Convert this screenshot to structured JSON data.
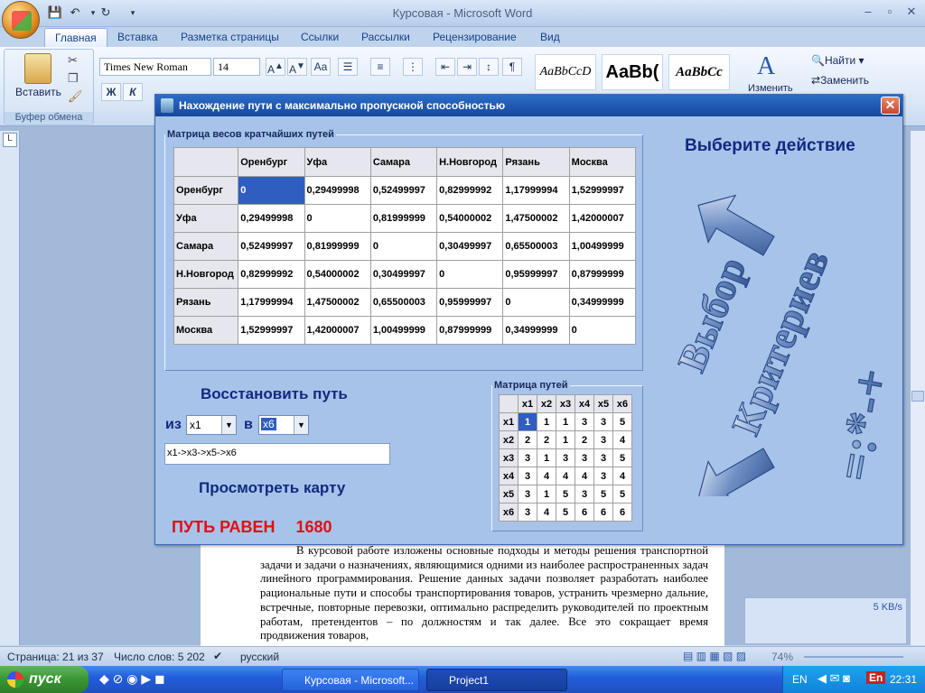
{
  "word": {
    "window_title": "Курсовая - Microsoft Word",
    "tabs": [
      "Главная",
      "Вставка",
      "Разметка страницы",
      "Ссылки",
      "Рассылки",
      "Рецензирование",
      "Вид"
    ],
    "ribbon": {
      "paste_label": "Вставить",
      "clipboard_group": "Буфер обмена",
      "font_name": "Times New Roman",
      "font_size": "14",
      "styles": [
        "AaBbCcD",
        "AaBb(",
        "AaBbCc"
      ],
      "edit_style_label": "Изменить",
      "find_label": "Найти",
      "replace_label": "Заменить",
      "bold": "Ж",
      "italic": "К"
    },
    "doc_text": "В курсовой работе изложены основные подходы и методы решения транспортной задачи и задачи о назначениях, являющимися одними из наиболее распространенных задач линейного программирования. Решение данных задачи позволяет разработать наиболее рациональные пути и способы транспортирования товаров, устранить чрезмерно дальние, встречные, повторные перевозки, оптимально распределить руководителей по проектным работам, претендентов – по должностям и так далее. Все это сокращает время продвижения товаров,",
    "status": {
      "page": "Страница: 21 из 37",
      "words": "Число слов: 5 202",
      "language": "русский",
      "zoom": "74%"
    },
    "net_speed": "5 KB/s"
  },
  "taskbar": {
    "start": "пуск",
    "tasks": [
      "Курсовая - Microsoft...",
      "Project1"
    ],
    "lang": "EN",
    "lang2": "En",
    "clock": "22:31"
  },
  "dialog": {
    "title": "Нахождение пути с максимально пропускной способностью",
    "weights_legend": "Матрица весов кратчайших путей",
    "cities": [
      "Оренбург",
      "Уфа",
      "Самара",
      "Н.Новгород",
      "Рязань",
      "Москва"
    ],
    "weights": [
      [
        "0",
        "0,29499998",
        "0,52499997",
        "0,82999992",
        "1,17999994",
        "1,52999997"
      ],
      [
        "0,29499998",
        "0",
        "0,81999999",
        "0,54000002",
        "1,47500002",
        "1,42000007"
      ],
      [
        "0,52499997",
        "0,81999999",
        "0",
        "0,30499997",
        "0,65500003",
        "1,00499999"
      ],
      [
        "0,82999992",
        "0,54000002",
        "0,30499997",
        "0",
        "0,95999997",
        "0,87999999"
      ],
      [
        "1,17999994",
        "1,47500002",
        "0,65500003",
        "0,95999997",
        "0",
        "0,34999999"
      ],
      [
        "1,52999997",
        "1,42000007",
        "1,00499999",
        "0,87999999",
        "0,34999999",
        "0"
      ]
    ],
    "choose_action": "Выберите действие",
    "criteria_1": "Выбор",
    "criteria_2": "Критериев",
    "restore_path": "Восстановить путь",
    "from_label": "из",
    "from_value": "x1",
    "to_label": "в",
    "to_value": "x6",
    "path_result": "x1->x3->x5->x6",
    "view_map": "Просмотреть карту",
    "path_equals_label": "ПУТЬ РАВЕН",
    "path_equals_value": "1680",
    "paths_legend": "Матрица путей",
    "path_headers": [
      "x1",
      "x2",
      "x3",
      "x4",
      "x5",
      "x6"
    ],
    "paths": [
      [
        "1",
        "1",
        "1",
        "3",
        "3",
        "5"
      ],
      [
        "2",
        "2",
        "1",
        "2",
        "3",
        "4"
      ],
      [
        "3",
        "1",
        "3",
        "3",
        "3",
        "5"
      ],
      [
        "3",
        "4",
        "4",
        "4",
        "3",
        "4"
      ],
      [
        "3",
        "1",
        "5",
        "3",
        "5",
        "5"
      ],
      [
        "3",
        "4",
        "5",
        "6",
        "6",
        "6"
      ]
    ]
  }
}
